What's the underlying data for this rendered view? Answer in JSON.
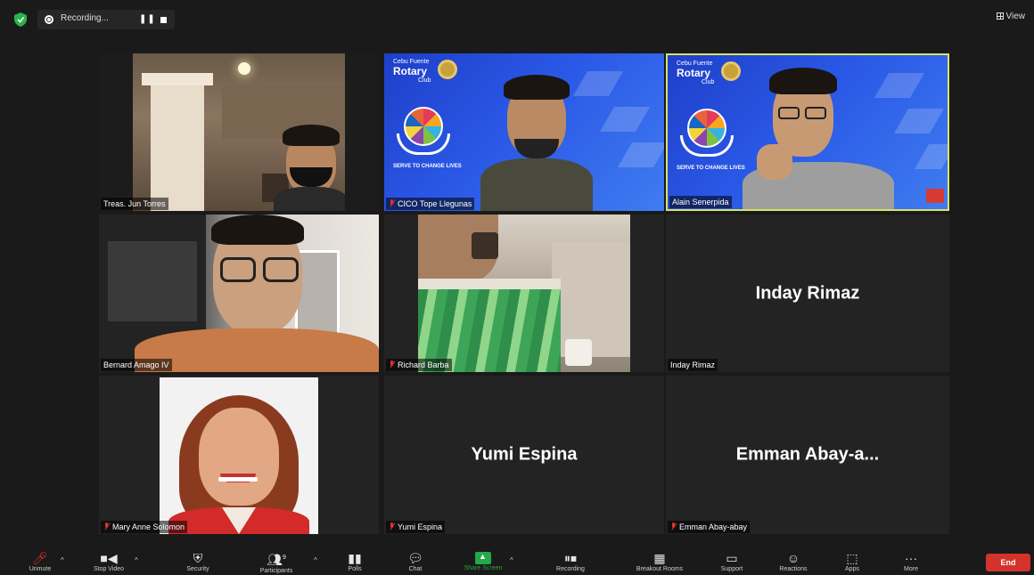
{
  "topbar": {
    "recording_label": "Recording...",
    "pause_glyph": "❚❚",
    "view_label": "View"
  },
  "participants": [
    {
      "name": "Treas. Jun Torres",
      "tile_text": "",
      "muted": false
    },
    {
      "name": "CICO Tope Llegunas",
      "tile_text": "",
      "muted": true
    },
    {
      "name": "Alain Senerpida",
      "tile_text": "",
      "muted": false,
      "active_speaker": true
    },
    {
      "name": "Bernard Amago IV",
      "tile_text": "",
      "muted": false
    },
    {
      "name": "Richard Barba",
      "tile_text": "",
      "muted": true
    },
    {
      "name": "Inday Rimaz",
      "tile_text": "Inday Rimaz",
      "muted": false
    },
    {
      "name": "Mary Anne Solomon",
      "tile_text": "",
      "muted": true
    },
    {
      "name": "Yumi Espina",
      "tile_text": "Yumi Espina",
      "muted": true
    },
    {
      "name": "Emman Abay-abay",
      "tile_text": "Emman  Abay-a...",
      "muted": true
    }
  ],
  "background": {
    "club_small": "Cebu Fuente",
    "club_big": "Rotary",
    "club_label": "Club",
    "slogan": "SERVE TO CHANGE LIVES"
  },
  "toolbar": {
    "items": [
      {
        "label": "Unmute",
        "icon": "microphone-muted-icon"
      },
      {
        "label": "Stop Video",
        "icon": "video-camera-icon"
      },
      {
        "label": "Security",
        "icon": "shield-icon"
      },
      {
        "label": "Participants",
        "icon": "participants-icon"
      },
      {
        "label": "Polls",
        "icon": "bar-chart-icon"
      },
      {
        "label": "Chat",
        "icon": "chat-bubble-icon"
      },
      {
        "label": "Share Screen",
        "icon": "share-screen-icon"
      },
      {
        "label": "Recording",
        "icon": "pause-stop-icon"
      },
      {
        "label": "Breakout Rooms",
        "icon": "breakout-rooms-icon"
      },
      {
        "label": "Support",
        "icon": "support-icon"
      },
      {
        "label": "Reactions",
        "icon": "reactions-icon"
      },
      {
        "label": "Apps",
        "icon": "apps-icon"
      },
      {
        "label": "More",
        "icon": "more-dots-icon"
      }
    ],
    "participant_count": "9",
    "end_label": "End"
  },
  "colors": {
    "active_speaker_border": "#d8e36a",
    "end_button": "#d3332b",
    "share_screen": "#23a84a",
    "mute_red": "#e0312b",
    "virtual_bg_blue": "#2a58e6"
  }
}
